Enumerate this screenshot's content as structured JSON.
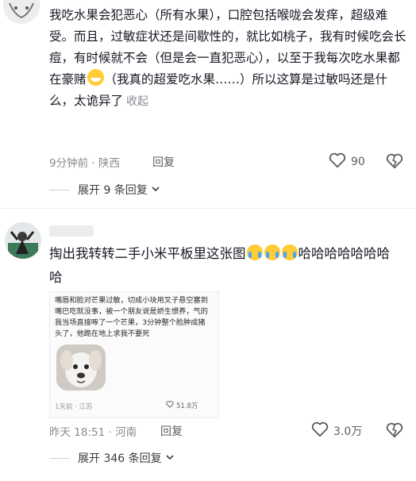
{
  "comment1": {
    "text": "我吃水果会犯恶心（所有水果），口腔包括喉咙会发痒，超级难受。而且，过敏症状还是间歇性的，就比如桃子，我有时候吃会长痘，有时候就不会（但是会一直犯恶心），以至于我每次吃水果都在豪赌",
    "text_after_emoji": "（我真的超爱吃水果……）所以这算是过敏吗还是什么，太诡异了",
    "collapse": "收起",
    "time_location": "9分钟前 · 陕西",
    "reply": "回复",
    "likes": "90",
    "expand_replies": "展开 9 条回复"
  },
  "comment2": {
    "text": "掏出我转转二手小米平板里这张图",
    "text_after_emoji": "哈哈哈哈哈哈哈哈",
    "embed": {
      "text": "嘴唇和脸对芒果过敏，切成小块用叉子悬空塞到嘴巴吃就没事，被一个朋友说是娇生惯养，气的我当场直接啄了一个芒果，3分钟整个脸肿成猪头了，他跪在地上求我不要死",
      "meta": "1天前 · 江苏",
      "likes": "51.8万"
    },
    "time_location": "昨天 18:51 · 河南",
    "reply": "回复",
    "likes": "3.0万",
    "expand_replies": "展开 346 条回复"
  },
  "icons": {
    "heart": "heart-outline-icon",
    "dislike": "broken-heart-icon",
    "chevron": "chevron-down-icon"
  },
  "colors": {
    "text": "#161823",
    "meta": "#8a8b91"
  }
}
